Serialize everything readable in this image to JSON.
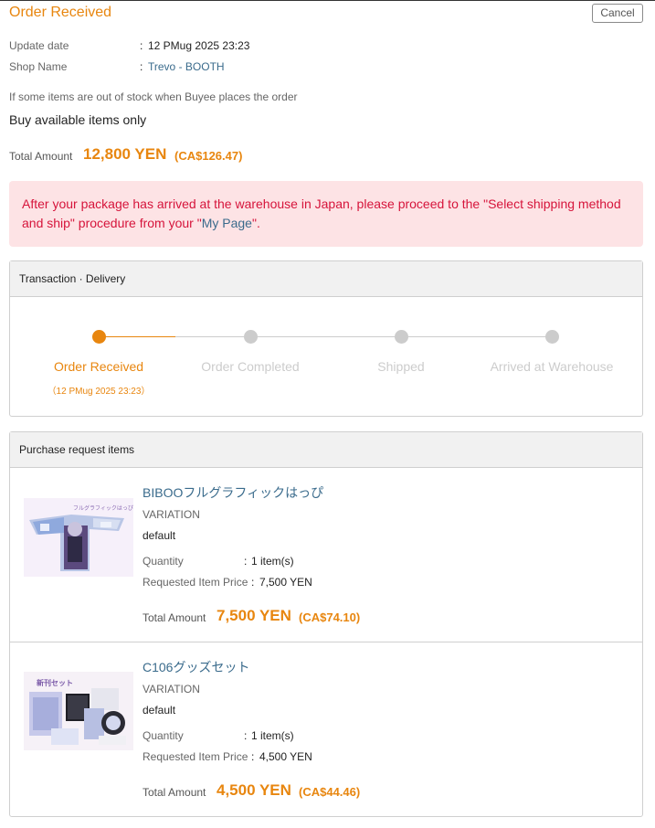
{
  "header": {
    "title": "Order Received",
    "cancel_label": "Cancel"
  },
  "info": {
    "update_label": "Update date",
    "update_value": "12 PMug 2025 23:23",
    "shop_label": "Shop Name",
    "shop_value": "Trevo - BOOTH",
    "colon": ":"
  },
  "stock_note": "If some items are out of stock when Buyee places the order",
  "stock_choice": "Buy available items only",
  "total": {
    "label": "Total Amount",
    "yen": "12,800 YEN",
    "cad": "(CA$126.47)"
  },
  "alert": {
    "text_before": "After your package has arrived at the warehouse in Japan, please proceed to the \"Select shipping method and ship\" procedure from your \"",
    "link": "My Page",
    "text_after": "\"."
  },
  "transaction": {
    "title": "Transaction · Delivery",
    "progress": {
      "completed_steps": 1,
      "total_steps": 4
    },
    "steps": [
      {
        "label": "Order Received",
        "date": "（12 PMug 2025 23:23）"
      },
      {
        "label": "Order Completed"
      },
      {
        "label": "Shipped"
      },
      {
        "label": "Arrived at Warehouse"
      }
    ]
  },
  "items_panel": {
    "title": "Purchase request items",
    "items": [
      {
        "name": "BIBOOフルグラフィックはっぴ",
        "thumb_caption": "フルグラフィックはっぴ",
        "variation_label": "VARIATION",
        "variation_value": "default",
        "quantity_label": "Quantity",
        "quantity_value": "1 item(s)",
        "price_label": "Requested Item Price",
        "price_value": "7,500 YEN",
        "total_label": "Total Amount",
        "total_yen": "7,500 YEN",
        "total_cad": "(CA$74.10)"
      },
      {
        "name": "C106グッズセット",
        "thumb_caption": "新刊セット",
        "variation_label": "VARIATION",
        "variation_value": "default",
        "quantity_label": "Quantity",
        "quantity_value": "1 item(s)",
        "price_label": "Requested Item Price",
        "price_value": "4,500 YEN",
        "total_label": "Total Amount",
        "total_yen": "4,500 YEN",
        "total_cad": "(CA$44.46)"
      }
    ]
  },
  "colors": {
    "accent": "#e8860f",
    "link": "#3a6b8c",
    "alert_bg": "#fde3e5",
    "alert_text": "#d6143b",
    "inactive": "#cccccc"
  },
  "icons": {
    "step_active": "filled-orange-circle",
    "step_inactive": "filled-grey-circle"
  }
}
